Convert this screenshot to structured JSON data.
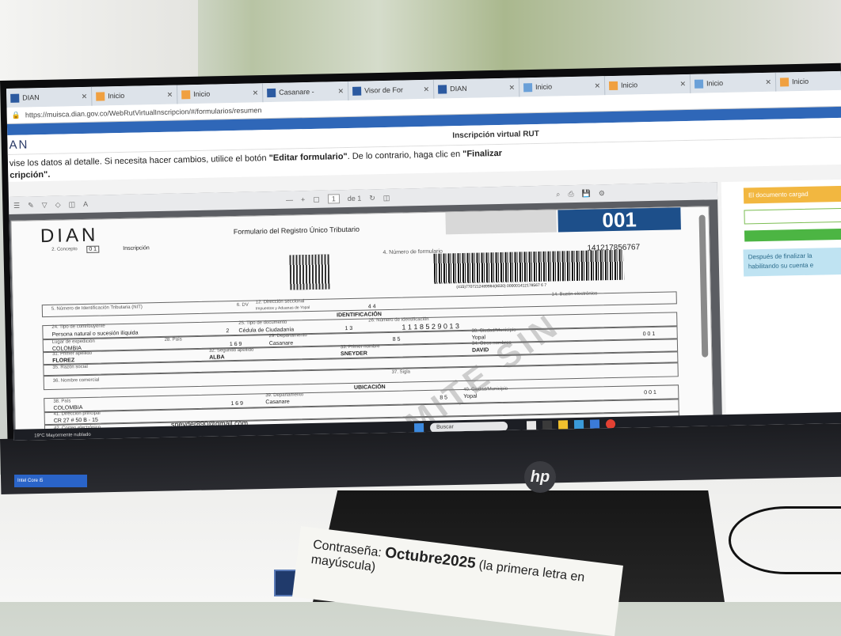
{
  "browser": {
    "tabs": [
      {
        "label": "DIAN",
        "favicon": "dian"
      },
      {
        "label": "Inicio",
        "favicon": "orange"
      },
      {
        "label": "Inicio",
        "favicon": "orange"
      },
      {
        "label": "Casanare - ",
        "favicon": "search"
      },
      {
        "label": "Visor de For",
        "favicon": "dian"
      },
      {
        "label": "DIAN",
        "favicon": "dian"
      },
      {
        "label": "Inicio",
        "favicon": "blue"
      },
      {
        "label": "Inicio",
        "favicon": "orange"
      },
      {
        "label": "Inicio",
        "favicon": "blue"
      },
      {
        "label": "Inicio",
        "favicon": "orange"
      }
    ],
    "url": "https://muisca.dian.gov.co/WebRutVirtualInscripcion/#/formularios/resumen"
  },
  "app": {
    "logo": "AN",
    "title": "Inscripción virtual RUT",
    "instructions_prefix": "vise los datos al detalle. Si necesita hacer cambios, utilice el botón ",
    "edit_button_ref": "\"Editar formulario\"",
    "instructions_mid": ". De lo contrario, haga clic en ",
    "finalize_ref": "\"Finalizar",
    "instructions_end": "cripción\"."
  },
  "viewer": {
    "page_current": "1",
    "page_total": "de 1"
  },
  "right_panel": {
    "warning": "El documento cargad",
    "info_line1": "Después de finalizar la",
    "info_line2": "habilitando su cuenta e"
  },
  "form": {
    "logo": "DIAN",
    "title": "Formulario del Registro Único Tributario",
    "number": "001",
    "concepto_label": "2. Concepto",
    "concepto_code": "0 1",
    "concepto_value": "Inscripción",
    "numero_formulario_label": "4. Número de formulario",
    "numero_formulario": "141217856767",
    "barcode_text": "(415)7707212489984(8020) 000001412178567 6 7",
    "nit_label": "5. Número de Identificación Tributaria (NIT)",
    "dv_label": "6. DV",
    "seccional_label": "12. Dirección seccional",
    "seccional_value": "Impuestos y Aduanas de Yopal",
    "buzon_label": "14. Buzón electrónico",
    "seccional_code": "4 4",
    "section_identificacion": "IDENTIFICACIÓN",
    "tipo_contribuyente_label": "24. Tipo de contribuyente",
    "tipo_contribuyente": "Persona natural o sucesión ilíquida",
    "tipo_contribuyente_code": "2",
    "tipo_documento_label": "25. Tipo de documento",
    "tipo_documento": "Cédula de Ciudadanía",
    "tipo_documento_code": "1 3",
    "numero_id_label": "26. Número de Identificación",
    "numero_id": "1 1 1 8 5 2 9 0 1 3",
    "lugar_expedicion_label": "Lugar de expedición",
    "pais_label": "28. País",
    "pais": "COLOMBIA",
    "pais_code": "1 6 9",
    "departamento_label": "29. Departamento",
    "departamento": "Casanare",
    "departamento_code": "8 5",
    "ciudad_label": "30. Ciudad/Municipio",
    "ciudad": "Yopal",
    "ciudad_code": "0 0 1",
    "primer_apellido_label": "31. Primer apellido",
    "primer_apellido": "FLOREZ",
    "segundo_apellido_label": "32. Segundo apellido",
    "segundo_apellido": "ALBA",
    "primer_nombre_label": "33. Primer nombre",
    "primer_nombre": "SNEYDER",
    "otros_nombres_label": "34. Otros nombres",
    "otros_nombres": "DAVID",
    "razon_social_label": "35. Razón social",
    "nombre_comercial_label": "36. Nombre comercial",
    "sigla_label": "37. Sigla",
    "section_ubicacion": "UBICACIÓN",
    "u_pais_label": "38. País",
    "u_pais": "COLOMBIA",
    "u_pais_code": "1 6 9",
    "u_departamento_label": "39. Departamento",
    "u_departamento": "Casanare",
    "u_departamento_code": "8 5",
    "u_ciudad_label": "40. Ciudad/Municipio",
    "u_ciudad": "Yopal",
    "u_ciudad_code": "0 0 1",
    "direccion_label": "41. Dirección principal",
    "direccion": "CR 27 # 50 B - 15",
    "correo_label": "42. Correo electrónico",
    "correo": "sneyder890@gmail.com",
    "watermark": "TRAMITE SIN COSTO"
  },
  "taskbar": {
    "weather": "19°C  Mayormente nublado",
    "search": "Buscar"
  },
  "sticky_note": {
    "prefix": "Contraseña: ",
    "password": "Octubre2025",
    "suffix": " (la primera letra en mayúscula)"
  },
  "monitor_brand": "hp",
  "sticker_text": "Intel Core i5"
}
